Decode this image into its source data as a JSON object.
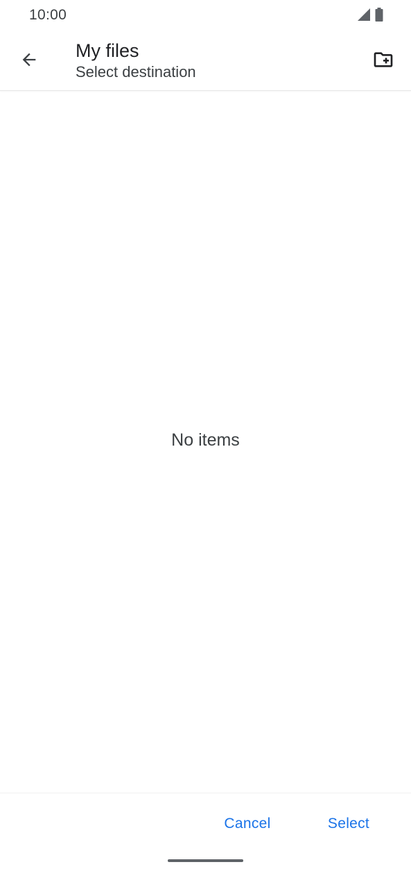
{
  "status_bar": {
    "time": "10:00",
    "icons": [
      "cellular-signal-icon",
      "battery-icon"
    ]
  },
  "app_bar": {
    "back_icon": "arrow-back-icon",
    "title": "My files",
    "subtitle": "Select destination",
    "new_folder_icon": "create-new-folder-icon"
  },
  "content": {
    "empty_message": "No items"
  },
  "actions": {
    "cancel_label": "Cancel",
    "select_label": "Select"
  },
  "colors": {
    "accent": "#1a73e8",
    "text_primary": "#202124",
    "text_secondary": "#3c4043",
    "icon": "#3c4043"
  }
}
